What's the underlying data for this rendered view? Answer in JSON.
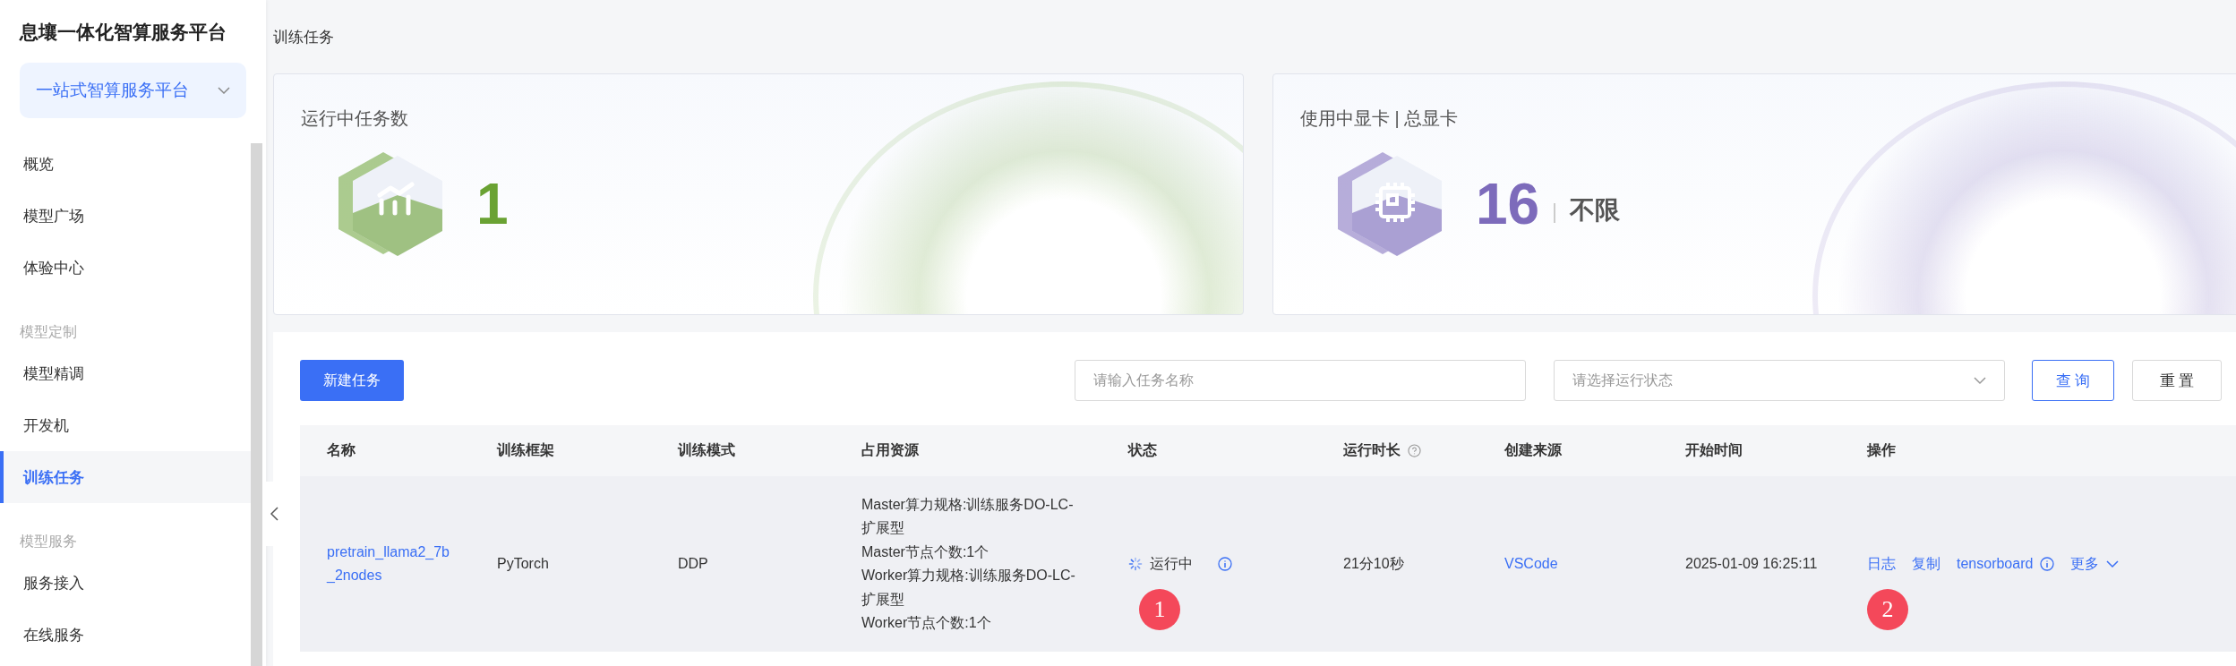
{
  "sidebar": {
    "title": "息壤一体化智算服务平台",
    "platform_select": {
      "value": "一站式智算服务平台"
    },
    "items": [
      {
        "kind": "item",
        "label": "概览",
        "selected": false
      },
      {
        "kind": "item",
        "label": "模型广场",
        "selected": false
      },
      {
        "kind": "item",
        "label": "体验中心",
        "selected": false
      },
      {
        "kind": "group",
        "label": "模型定制"
      },
      {
        "kind": "item",
        "label": "模型精调",
        "selected": false
      },
      {
        "kind": "item",
        "label": "开发机",
        "selected": false
      },
      {
        "kind": "item",
        "label": "训练任务",
        "selected": true
      },
      {
        "kind": "group",
        "label": "模型服务"
      },
      {
        "kind": "item",
        "label": "服务接入",
        "selected": false
      },
      {
        "kind": "item",
        "label": "在线服务",
        "selected": false
      }
    ]
  },
  "page_title": "训练任务",
  "stat_cards": [
    {
      "kind": "tasks",
      "title": "运行中任务数",
      "value": "1",
      "color": "#6aa233"
    },
    {
      "kind": "gpu",
      "title": "使用中显卡 | 总显卡",
      "value": "16",
      "total": "不限",
      "color": "#7d6bbb"
    }
  ],
  "toolbar": {
    "new_button": "新建任务",
    "search": {
      "placeholder": "请输入任务名称"
    },
    "status_select": {
      "placeholder": "请选择运行状态"
    },
    "buttons": [
      {
        "kind": "primary",
        "label": "查 询"
      },
      {
        "kind": "default",
        "label": "重 置"
      }
    ]
  },
  "table": {
    "columns": [
      {
        "label": "名称",
        "help": false
      },
      {
        "label": "训练框架",
        "help": false
      },
      {
        "label": "训练模式",
        "help": false
      },
      {
        "label": "占用资源",
        "help": false
      },
      {
        "label": "状态",
        "help": false
      },
      {
        "label": "运行时长",
        "help": true
      },
      {
        "label": "创建来源",
        "help": false
      },
      {
        "label": "开始时间",
        "help": false
      },
      {
        "label": "操作",
        "help": false
      }
    ],
    "rows": [
      {
        "name": "pretrain_llama2_7b_2nodes",
        "framework": "PyTorch",
        "mode": "DDP",
        "resources": [
          "Master算力规格:训练服务DO-LC-扩展型",
          "Master节点个数:1个",
          "Worker算力规格:训练服务DO-LC-扩展型",
          "Worker节点个数:1个"
        ],
        "status": "运行中",
        "status_badge": "1",
        "duration": "21分10秒",
        "source": "VSCode",
        "start_time": "2025-01-09 16:25:11",
        "actions": [
          {
            "kind": "link",
            "label": "日志"
          },
          {
            "kind": "link",
            "label": "复制"
          },
          {
            "kind": "info",
            "label": "tensorboard"
          },
          {
            "kind": "dropdown",
            "label": "更多"
          }
        ],
        "actions_badge": "2"
      }
    ]
  }
}
